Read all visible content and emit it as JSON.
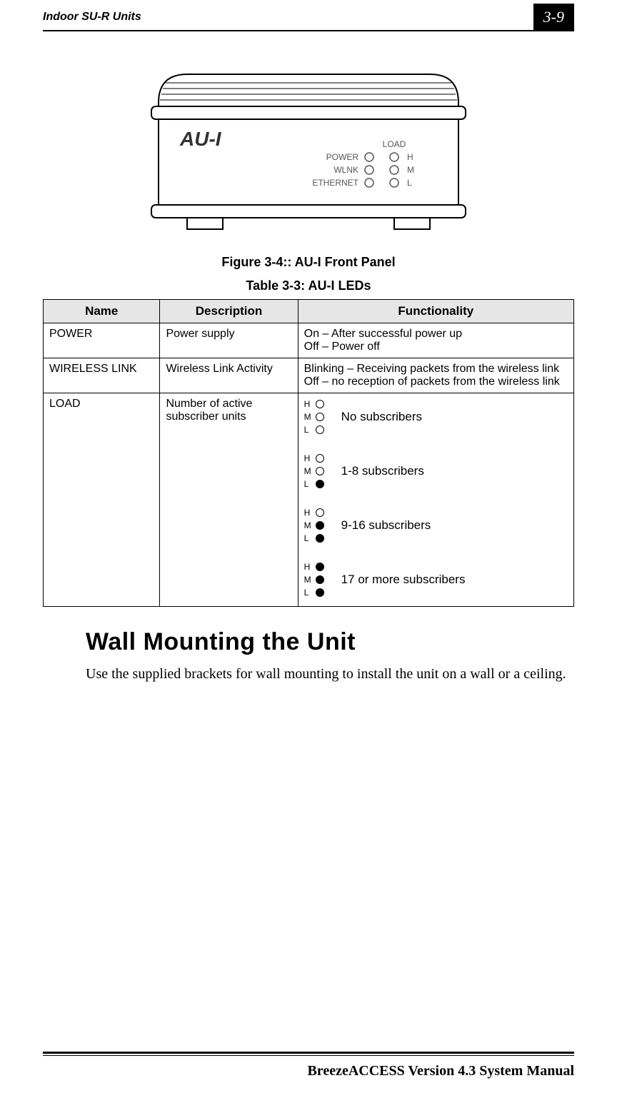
{
  "header": {
    "section": "Indoor SU-R Units",
    "page_number": "3-9"
  },
  "device_panel": {
    "model_label": "AU-I",
    "labels": {
      "power": "POWER",
      "wlnk": "WLNK",
      "ethernet": "ETHERNET",
      "load": "LOAD",
      "h": "H",
      "m": "M",
      "l": "L"
    }
  },
  "figure_caption": "Figure 3-4:: AU-I Front Panel",
  "table_caption": "Table 3-3: AU-I LEDs",
  "table": {
    "headers": {
      "name": "Name",
      "description": "Description",
      "functionality": "Functionality"
    },
    "rows": {
      "power": {
        "name": "POWER",
        "description": "Power supply",
        "func_line1": "On – After successful power up",
        "func_line2": "Off – Power off"
      },
      "wireless": {
        "name": "WIRELESS LINK",
        "description": "Wireless Link Activity",
        "func_line1": "Blinking – Receiving packets from the wireless link",
        "func_line2": "Off – no reception of packets from the wireless link"
      },
      "load": {
        "name": "LOAD",
        "description": "Number of active subscriber units",
        "hml": {
          "h": "H",
          "m": "M",
          "l": "L"
        },
        "state1": "No subscribers",
        "state2": "1-8 subscribers",
        "state3": "9-16 subscribers",
        "state4": "17 or more subscribers"
      }
    }
  },
  "section": {
    "title": "Wall Mounting the Unit",
    "body": "Use the supplied brackets for wall mounting to install the unit on a wall or a ceiling."
  },
  "footer": {
    "manual_title": "BreezeACCESS Version 4.3 System Manual"
  }
}
